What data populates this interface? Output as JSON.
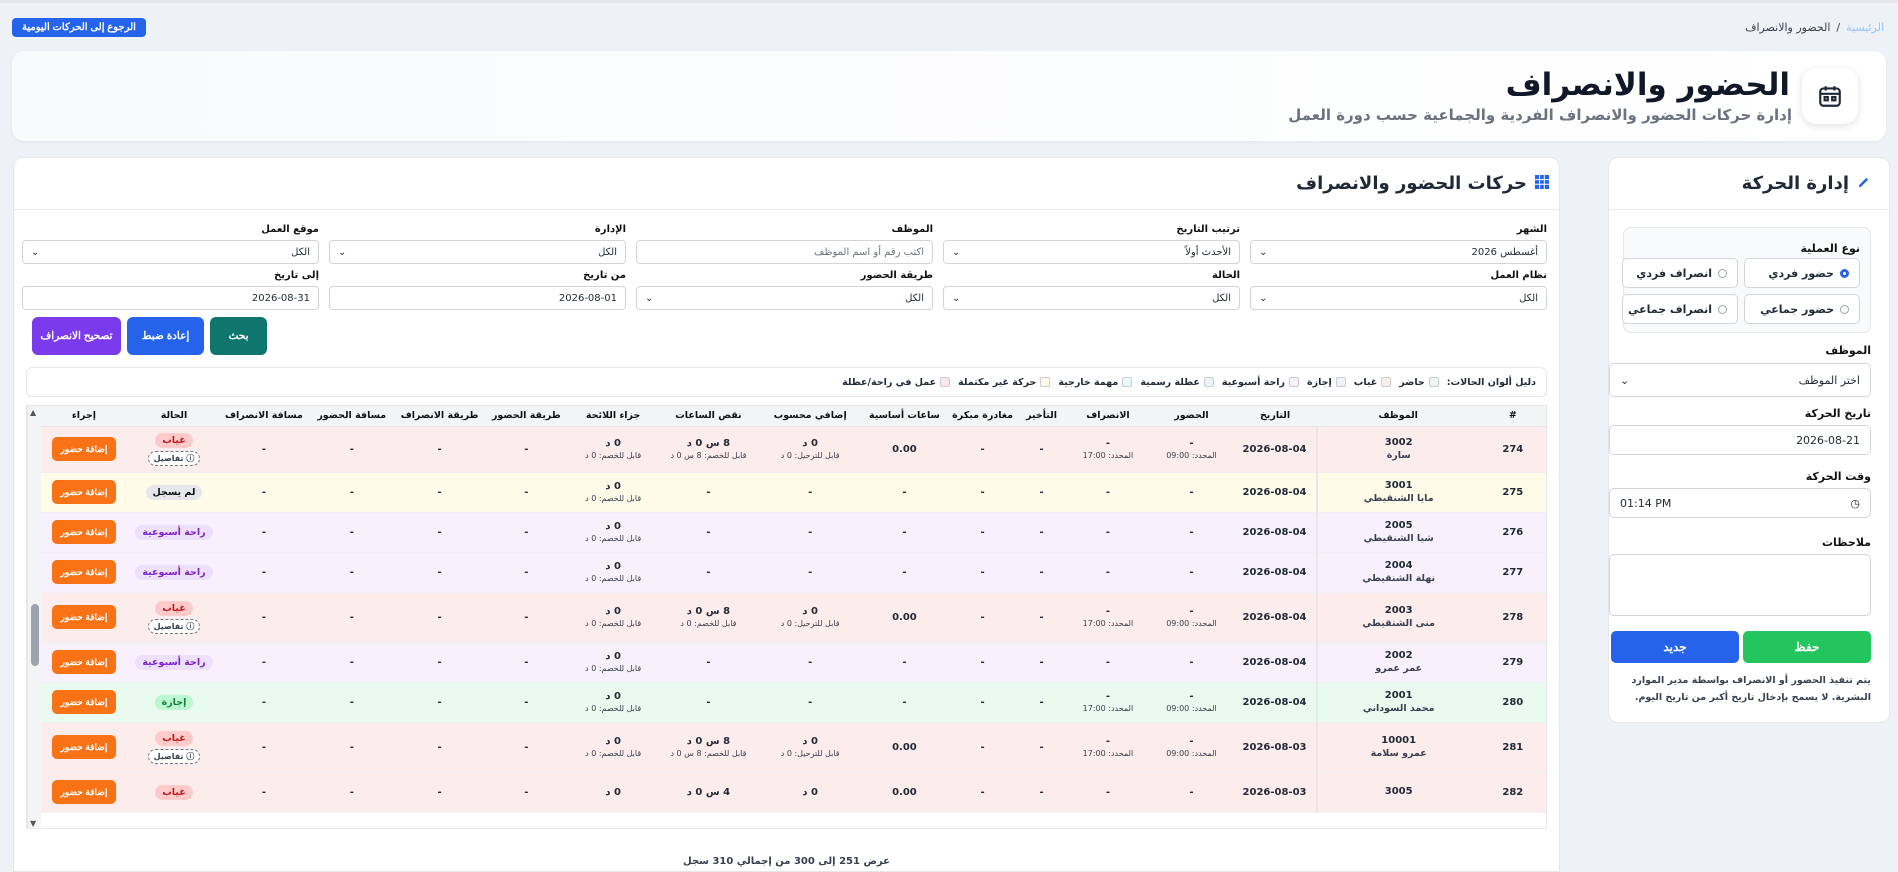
{
  "breadcrumb": {
    "home": "الرئيسية",
    "sep": "/",
    "current": "الحضور والانصراف"
  },
  "back_button": "الرجوع إلى الحركات اليومية",
  "header": {
    "title": "الحضور والانصراف",
    "subtitle": "إدارة حركات الحضور والانصراف الفردية والجماعية حسب دورة العمل"
  },
  "side": {
    "title": "إدارة الحركة",
    "op_type_label": "نوع العملية",
    "options": [
      "حضور فردي",
      "انصراف فردي",
      "حضور جماعي",
      "انصراف جماعي"
    ],
    "employee_label": "الموظف",
    "employee_value": "اختر الموظف",
    "date_label": "تاريخ الحركة",
    "date_value": "2026-08-21",
    "time_label": "وقت الحركة",
    "time_value": "01:14 PM",
    "notes_label": "ملاحظات",
    "save": "حفظ",
    "new": "جديد",
    "note": "يتم تنفيذ الحضور أو الانصراف بواسطة مدير الموارد البشرية. لا يسمح بإدخال تاريخ أكبر من تاريخ اليوم."
  },
  "main": {
    "title": "حركات الحضور والانصراف",
    "filters": {
      "month_label": "الشهر",
      "month_value": "أغسطس 2026",
      "sort_label": "ترتيب التاريخ",
      "sort_value": "الأحدث أولاً",
      "emp_label": "الموظف",
      "emp_placeholder": "اكتب رقم أو اسم الموظف",
      "dept_label": "الإدارة",
      "dept_value": "الكل",
      "site_label": "موقع العمل",
      "site_value": "الكل",
      "system_label": "نظام العمل",
      "system_value": "الكل",
      "status_label": "الحالة",
      "status_value": "الكل",
      "method_label": "طريقة الحضور",
      "method_value": "الكل",
      "from_label": "من تاريخ",
      "from_value": "2026-08-01",
      "to_label": "إلى تاريخ",
      "to_value": "2026-08-31"
    },
    "buttons": {
      "search": "بحث",
      "reset": "إعادة ضبط",
      "fix": "تصحيح الانصراف"
    },
    "legend_title": "دليل ألوان الحالات:",
    "legend": [
      {
        "label": "حاضر",
        "color": "#e9fbef"
      },
      {
        "label": "غياب",
        "color": "#fdecec"
      },
      {
        "label": "إجازة",
        "color": "#eef2ff"
      },
      {
        "label": "راحة أسبوعية",
        "color": "#f8f1fd"
      },
      {
        "label": "عطلة رسمية",
        "color": "#eaf4fb"
      },
      {
        "label": "مهمة خارجية",
        "color": "#e6fbfb"
      },
      {
        "label": "حركة غير مكتملة",
        "color": "#fefce8"
      },
      {
        "label": "عمل في راحة/عطلة",
        "color": "#fde8f1"
      }
    ],
    "columns": [
      "#",
      "الموظف",
      "التاريخ",
      "الحضور",
      "الانصراف",
      "التأخير",
      "مغادرة مبكرة",
      "ساعات أساسية",
      "إضافي محسوب",
      "نقص الساعات",
      "جزاء اللائحة",
      "طريقة الحضور",
      "طريقة الانصراف",
      "مسافة الحضور",
      "مسافة الانصراف",
      "الحالة",
      "إجراء"
    ],
    "add_label": "إضافة حضور",
    "details_label": "ⓘ تفاصيل",
    "rows": [
      {
        "n": "274",
        "code": "3002",
        "name": "سارة",
        "date": "2026-08-04",
        "in": "-",
        "in_sub": "المحدد: 09:00",
        "out": "-",
        "out_sub": "المحدد: 17:00",
        "late": "-",
        "early": "-",
        "basic": "0.00",
        "ot": "0 د",
        "ot_sub": "قابل للترحيل: 0 د",
        "short": "8 س 0 د",
        "short_sub": "قابل للخصم: 8 س 0 د",
        "pen": "0 د",
        "pen_sub": "قابل للخصم: 0 د",
        "status": "غياب",
        "cls": "red",
        "badge": "b-red",
        "details": true
      },
      {
        "n": "275",
        "code": "3001",
        "name": "مايا الشنقيطي",
        "date": "2026-08-04",
        "in": "-",
        "in_sub": "",
        "out": "-",
        "out_sub": "",
        "late": "-",
        "early": "-",
        "basic": "-",
        "ot": "-",
        "ot_sub": "",
        "short": "-",
        "short_sub": "",
        "pen": "0 د",
        "pen_sub": "قابل للخصم: 0 د",
        "status": "لم يسجل",
        "cls": "yel",
        "badge": "b-gray",
        "details": false
      },
      {
        "n": "276",
        "code": "2005",
        "name": "شيا الشنقيطي",
        "date": "2026-08-04",
        "in": "-",
        "in_sub": "",
        "out": "-",
        "out_sub": "",
        "late": "-",
        "early": "-",
        "basic": "-",
        "ot": "-",
        "ot_sub": "",
        "short": "-",
        "short_sub": "",
        "pen": "0 د",
        "pen_sub": "قابل للخصم: 0 د",
        "status": "راحة أسبوعية",
        "cls": "pur",
        "badge": "b-pur",
        "details": false
      },
      {
        "n": "277",
        "code": "2004",
        "name": "نهلة الشنقيطي",
        "date": "2026-08-04",
        "in": "-",
        "in_sub": "",
        "out": "-",
        "out_sub": "",
        "late": "-",
        "early": "-",
        "basic": "-",
        "ot": "-",
        "ot_sub": "",
        "short": "-",
        "short_sub": "",
        "pen": "0 د",
        "pen_sub": "قابل للخصم: 0 د",
        "status": "راحة أسبوعية",
        "cls": "pur",
        "badge": "b-pur",
        "details": false
      },
      {
        "n": "278",
        "code": "2003",
        "name": "منى الشنقيطي",
        "date": "2026-08-04",
        "in": "-",
        "in_sub": "المحدد: 09:00",
        "out": "-",
        "out_sub": "المحدد: 17:00",
        "late": "-",
        "early": "-",
        "basic": "0.00",
        "ot": "0 د",
        "ot_sub": "قابل للترحيل: 0 د",
        "short": "8 س 0 د",
        "short_sub": "قابل للخصم: 0 د",
        "pen": "0 د",
        "pen_sub": "قابل للخصم: 0 د",
        "status": "غياب",
        "cls": "red",
        "badge": "b-red",
        "details": true
      },
      {
        "n": "279",
        "code": "2002",
        "name": "عمر عمرو",
        "date": "2026-08-04",
        "in": "-",
        "in_sub": "",
        "out": "-",
        "out_sub": "",
        "late": "-",
        "early": "-",
        "basic": "-",
        "ot": "-",
        "ot_sub": "",
        "short": "-",
        "short_sub": "",
        "pen": "0 د",
        "pen_sub": "قابل للخصم: 0 د",
        "status": "راحة أسبوعية",
        "cls": "pur",
        "badge": "b-pur",
        "details": false
      },
      {
        "n": "280",
        "code": "2001",
        "name": "محمد السوداني",
        "date": "2026-08-04",
        "in": "-",
        "in_sub": "المحدد: 09:00",
        "out": "-",
        "out_sub": "المحدد: 17:00",
        "late": "-",
        "early": "-",
        "basic": "-",
        "ot": "-",
        "ot_sub": "",
        "short": "-",
        "short_sub": "",
        "pen": "0 د",
        "pen_sub": "قابل للخصم: 0 د",
        "status": "إجازة",
        "cls": "grn",
        "badge": "b-grn",
        "details": false
      },
      {
        "n": "281",
        "code": "10001",
        "name": "عمرو سلامة",
        "date": "2026-08-03",
        "in": "-",
        "in_sub": "المحدد: 09:00",
        "out": "-",
        "out_sub": "المحدد: 17:00",
        "late": "-",
        "early": "-",
        "basic": "0.00",
        "ot": "0 د",
        "ot_sub": "قابل للترحيل: 0 د",
        "short": "8 س 0 د",
        "short_sub": "قابل للخصم: 8 س 0 د",
        "pen": "0 د",
        "pen_sub": "قابل للخصم: 0 د",
        "status": "غياب",
        "cls": "red",
        "badge": "b-red",
        "details": true
      },
      {
        "n": "282",
        "code": "3005",
        "name": "",
        "date": "2026-08-03",
        "in": "-",
        "in_sub": "",
        "out": "-",
        "out_sub": "",
        "late": "-",
        "early": "-",
        "basic": "0.00",
        "ot": "0 د",
        "ot_sub": "",
        "short": "4 س 0 د",
        "short_sub": "",
        "pen": "0 د",
        "pen_sub": "",
        "status": "غياب",
        "cls": "red",
        "badge": "b-red",
        "details": false
      }
    ],
    "pager": "عرض 251 إلى 300 من إجمالي 310 سجل"
  }
}
